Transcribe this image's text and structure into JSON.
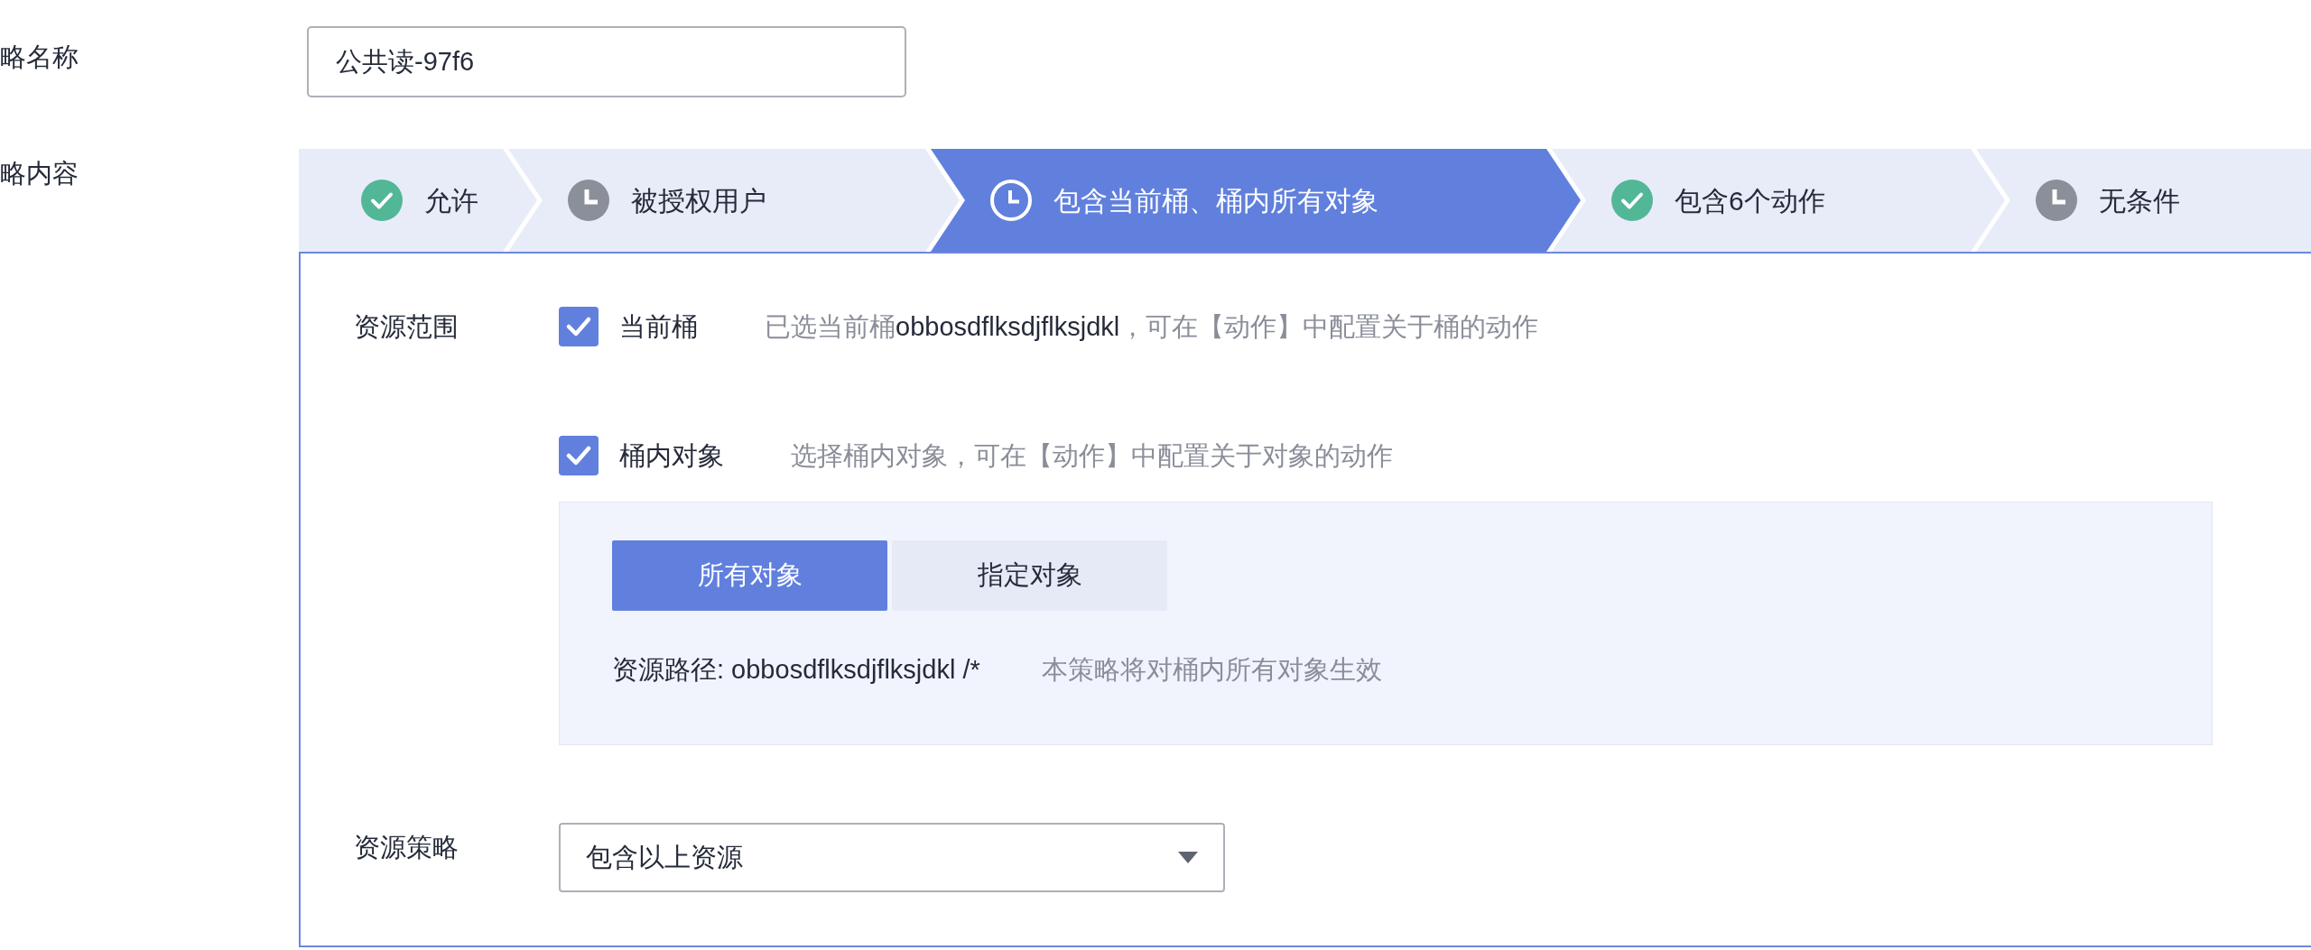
{
  "policy_name": {
    "label": "略名称",
    "value": "公共读-97f6"
  },
  "policy_content": {
    "label": "略内容",
    "steps": [
      {
        "label": "允许",
        "kind": "done",
        "selected": false
      },
      {
        "label": "被授权用户",
        "kind": "pending",
        "selected": false
      },
      {
        "label": "包含当前桶、桶内所有对象",
        "kind": "pending",
        "selected": true
      },
      {
        "label": "包含6个动作",
        "kind": "done",
        "selected": false
      },
      {
        "label": "无条件",
        "kind": "pending",
        "selected": false
      }
    ],
    "resource_scope": {
      "label": "资源范围",
      "options": [
        {
          "label": "当前桶",
          "checked": true,
          "hint": "已选当前桶**obbosdflksdjflksjdkl**，可在【动作】中配置关于桶的动作"
        },
        {
          "label": "桶内对象",
          "checked": true,
          "hint": "选择桶内对象，可在【动作】中配置关于对象的动作"
        }
      ]
    },
    "object_scope": {
      "tabs": [
        {
          "label": "所有对象",
          "selected": true
        },
        {
          "label": "指定对象",
          "selected": false
        }
      ],
      "resource_path": "资源路径: obbosdflksdjflksjdkl /*",
      "hint": "本策略将对桶内所有对象生效"
    },
    "resource_policy": {
      "label": "资源策略",
      "value": "包含以上资源"
    }
  }
}
